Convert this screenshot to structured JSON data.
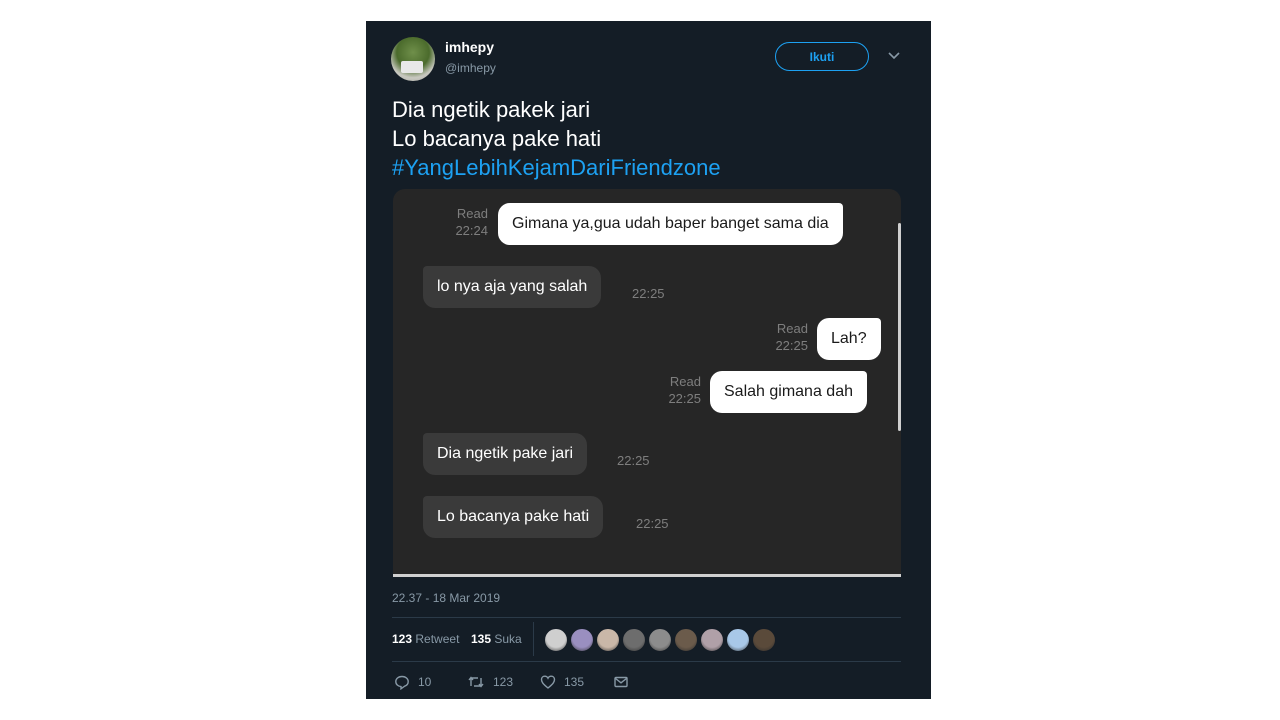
{
  "user": {
    "name": "imhepy",
    "handle": "@imhepy"
  },
  "follow_label": "Ikuti",
  "tweet": {
    "line1": "Dia ngetik pakek jari",
    "line2": "Lo bacanya pake hati",
    "hashtag": "#YangLebihKejamDariFriendzone"
  },
  "chat": {
    "messages": [
      {
        "side": "out",
        "text": "Gimana ya,gua udah baper banget sama dia",
        "status": "Read",
        "time": "22:24"
      },
      {
        "side": "in",
        "text": "lo nya aja yang salah",
        "time": "22:25"
      },
      {
        "side": "out",
        "text": "Lah?",
        "status": "Read",
        "time": "22:25"
      },
      {
        "side": "out",
        "text": "Salah gimana dah",
        "status": "Read",
        "time": "22:25"
      },
      {
        "side": "in",
        "text": "Dia ngetik pake jari",
        "time": "22:25"
      },
      {
        "side": "in",
        "text": "Lo bacanya pake hati",
        "time": "22:25"
      }
    ]
  },
  "date": "22.37 - 18 Mar 2019",
  "stats": {
    "retweets": "123",
    "retweets_label": "Retweet",
    "likes": "135",
    "likes_label": "Suka"
  },
  "likers": [
    "#cfcfcf",
    "#9a8fc0",
    "#c9b7a8",
    "#6d6d6d",
    "#8c8c8c",
    "#6b5b4b",
    "#b0a0a8",
    "#a8c8e8",
    "#5a4a3a"
  ],
  "actions": {
    "replies": "10",
    "retweets": "123",
    "likes": "135"
  },
  "colors": {
    "background": "#141d26",
    "accent": "#1da1f2",
    "muted": "#8899a6"
  }
}
